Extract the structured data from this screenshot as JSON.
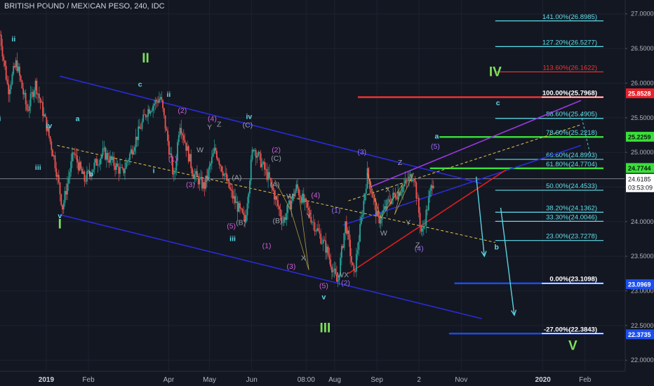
{
  "header": {
    "symbol_title": "BRITISH POUND / MEXICAN PESO, 240, IDC"
  },
  "colors": {
    "background": "#131722",
    "candle_up": "#26a69a",
    "candle_down": "#ef5350",
    "channel": "#2b2bd6",
    "fib_cyan": "#5ee0ea",
    "fib_red": "#ef3535",
    "fib_green": "#3ae03a",
    "fib_white": "#ffffff",
    "fib_blue": "#1c4ff0",
    "wave_green": "#7ee05a",
    "wave_cyan": "#62d6e4",
    "wave_magenta": "#d05cd8",
    "wave_purple": "#9a6cf0",
    "wave_gray": "#9a9ea8",
    "trend_yellow": "#e6c64a",
    "purple_channel": "#9a3ae0",
    "red_channel": "#e01e1e",
    "arrow": "#5ad2e0"
  },
  "chart_data": {
    "type": "candlestick",
    "title": "BRITISH POUND / MEXICAN PESO, 240, IDC",
    "x_axis": {
      "labels": [
        "2019",
        "Feb",
        "Apr",
        "May",
        "Jun",
        "08:00",
        "Aug",
        "Sep",
        "2",
        "Nov",
        "2020",
        "Feb"
      ],
      "positions_days": [
        0,
        31,
        90,
        120,
        151,
        191,
        212,
        243,
        274,
        305,
        365,
        396
      ],
      "range_days": [
        -34,
        425
      ]
    },
    "y_axis": {
      "labels": [
        "27.0000",
        "26.5000",
        "26.0000",
        "25.5000",
        "25.0000",
        "24.5000",
        "24.0000",
        "23.5000",
        "23.0000",
        "22.5000",
        "22.0000"
      ],
      "range": [
        21.85,
        27.2
      ],
      "current_price": "24.6185",
      "countdown": "03:53:09"
    },
    "price_path": [
      {
        "day": -34,
        "price": 26.7
      },
      {
        "day": -28,
        "price": 25.9
      },
      {
        "day": -22,
        "price": 26.3
      },
      {
        "day": -14,
        "price": 25.6
      },
      {
        "day": -8,
        "price": 26.0
      },
      {
        "day": 0,
        "price": 25.4
      },
      {
        "day": 6,
        "price": 24.9
      },
      {
        "day": 12,
        "price": 24.2
      },
      {
        "day": 20,
        "price": 25.0
      },
      {
        "day": 28,
        "price": 24.6
      },
      {
        "day": 42,
        "price": 25.0
      },
      {
        "day": 56,
        "price": 24.7
      },
      {
        "day": 74,
        "price": 25.6
      },
      {
        "day": 84,
        "price": 25.8
      },
      {
        "day": 94,
        "price": 24.6
      },
      {
        "day": 98,
        "price": 25.45
      },
      {
        "day": 108,
        "price": 24.7
      },
      {
        "day": 116,
        "price": 24.5
      },
      {
        "day": 124,
        "price": 25.05
      },
      {
        "day": 136,
        "price": 24.4
      },
      {
        "day": 146,
        "price": 24.0
      },
      {
        "day": 152,
        "price": 25.1
      },
      {
        "day": 164,
        "price": 24.6
      },
      {
        "day": 174,
        "price": 24.0
      },
      {
        "day": 184,
        "price": 24.5
      },
      {
        "day": 196,
        "price": 24.0
      },
      {
        "day": 206,
        "price": 23.6
      },
      {
        "day": 214,
        "price": 23.1
      },
      {
        "day": 220,
        "price": 24.0
      },
      {
        "day": 226,
        "price": 23.2
      },
      {
        "day": 236,
        "price": 24.7
      },
      {
        "day": 244,
        "price": 24.0
      },
      {
        "day": 252,
        "price": 24.3
      },
      {
        "day": 262,
        "price": 24.5
      },
      {
        "day": 270,
        "price": 24.7
      },
      {
        "day": 276,
        "price": 23.8
      },
      {
        "day": 284,
        "price": 24.6
      }
    ],
    "fib_levels": [
      {
        "label": "141.00%(26.8985)",
        "price": 26.8985,
        "color": "cyan"
      },
      {
        "label": "127.20%(26.5277)",
        "price": 26.5277,
        "color": "cyan"
      },
      {
        "label": "113.60%(26.1622)",
        "price": 26.1622,
        "color": "red"
      },
      {
        "label": "100.00%(25.7968)",
        "price": 25.7968,
        "color": "white"
      },
      {
        "label": "88.60%(25.4905)",
        "price": 25.4905,
        "color": "cyan"
      },
      {
        "label": "78.60%(25.2218)",
        "price": 25.2218,
        "color": "green"
      },
      {
        "label": "66.60%(24.8993)",
        "price": 24.8993,
        "color": "cyan"
      },
      {
        "label": "61.80%(24.7704)",
        "price": 24.7704,
        "color": "green"
      },
      {
        "label": "50.00%(24.4533)",
        "price": 24.4533,
        "color": "cyan"
      },
      {
        "label": "38.20%(24.1362)",
        "price": 24.1362,
        "color": "cyan"
      },
      {
        "label": "33.30%(24.0046)",
        "price": 24.0046,
        "color": "cyan"
      },
      {
        "label": "23.00%(23.7278)",
        "price": 23.7278,
        "color": "cyan"
      },
      {
        "label": "0.00%(23.1098)",
        "price": 23.1098,
        "color": "white"
      },
      {
        "label": "-27.00%(22.3843)",
        "price": 22.3843,
        "color": "white"
      }
    ],
    "price_tags": [
      {
        "text": "25.8528",
        "price": 25.8528,
        "bg": "#e8212a",
        "fg": "#ffffff"
      },
      {
        "text": "25.2259",
        "price": 25.2259,
        "bg": "#3ae03a",
        "fg": "#0c1a0c"
      },
      {
        "text": "24.7744",
        "price": 24.7744,
        "bg": "#3ae03a",
        "fg": "#0c1a0c"
      },
      {
        "text": "23.0969",
        "price": 23.0969,
        "bg": "#1c4ff0",
        "fg": "#ffffff"
      },
      {
        "text": "22.3735",
        "price": 22.3735,
        "bg": "#1c4ff0",
        "fg": "#ffffff"
      }
    ],
    "channels": [
      {
        "name": "upper-blue",
        "color": "channel",
        "from": [
          10,
          26.1
        ],
        "to": [
          320,
          24.55
        ]
      },
      {
        "name": "lower-blue",
        "color": "channel",
        "from": [
          10,
          24.1
        ],
        "to": [
          320,
          22.6
        ]
      },
      {
        "name": "purple-upper",
        "color": "purple_channel",
        "from": [
          238,
          24.5
        ],
        "to": [
          393,
          25.75
        ]
      },
      {
        "name": "blue-mid",
        "color": "channel",
        "from": [
          218,
          23.95
        ],
        "to": [
          393,
          25.1
        ]
      },
      {
        "name": "red-lower",
        "color": "red_channel",
        "from": [
          222,
          23.25
        ],
        "to": [
          338,
          24.75
        ]
      }
    ],
    "wave_labels": [
      {
        "text": "i",
        "day": -34,
        "price": 25.45,
        "color": "cyan"
      },
      {
        "text": "ii",
        "day": -24,
        "price": 26.6,
        "color": "cyan"
      },
      {
        "text": "iv",
        "day": 2,
        "price": 25.35,
        "color": "cyan"
      },
      {
        "text": "iii",
        "day": -6,
        "price": 24.75,
        "color": "cyan"
      },
      {
        "text": "v",
        "day": 10,
        "price": 24.05,
        "color": "cyan"
      },
      {
        "text": "I",
        "day": 10,
        "price": 23.9,
        "color": "green",
        "big": true
      },
      {
        "text": "a",
        "day": 23,
        "price": 25.45,
        "color": "cyan"
      },
      {
        "text": "b",
        "day": 33,
        "price": 24.65,
        "color": "cyan"
      },
      {
        "text": "c",
        "day": 69,
        "price": 25.95,
        "color": "cyan"
      },
      {
        "text": "II",
        "day": 73,
        "price": 26.3,
        "color": "green",
        "big": true
      },
      {
        "text": "ii",
        "day": 90,
        "price": 25.8,
        "color": "cyan"
      },
      {
        "text": "(2)",
        "day": 100,
        "price": 25.57,
        "color": "magenta"
      },
      {
        "text": "i",
        "day": 79,
        "price": 24.7,
        "color": "cyan"
      },
      {
        "text": "(1)",
        "day": 93,
        "price": 24.87,
        "color": "magenta"
      },
      {
        "text": "(3)",
        "day": 106,
        "price": 24.5,
        "color": "magenta"
      },
      {
        "text": "(4)",
        "day": 122,
        "price": 25.45,
        "color": "magenta"
      },
      {
        "text": "Y",
        "day": 120,
        "price": 25.33,
        "color": "gray"
      },
      {
        "text": "Z",
        "day": 127,
        "price": 25.37,
        "color": "gray"
      },
      {
        "text": "W",
        "day": 113,
        "price": 25.0,
        "color": "gray"
      },
      {
        "text": "X",
        "day": 119,
        "price": 24.58,
        "color": "gray"
      },
      {
        "text": "iv",
        "day": 149,
        "price": 25.48,
        "color": "cyan"
      },
      {
        "text": "(C)",
        "day": 148,
        "price": 25.36,
        "color": "gray"
      },
      {
        "text": "(5)",
        "day": 136,
        "price": 23.9,
        "color": "magenta"
      },
      {
        "text": "(B)",
        "day": 143,
        "price": 23.95,
        "color": "gray"
      },
      {
        "text": "iii",
        "day": 137,
        "price": 23.72,
        "color": "cyan"
      },
      {
        "text": "(A)",
        "day": 140,
        "price": 24.6,
        "color": "gray"
      },
      {
        "text": "(2)",
        "day": 169,
        "price": 25.0,
        "color": "magenta"
      },
      {
        "text": "(C)",
        "day": 169,
        "price": 24.88,
        "color": "gray"
      },
      {
        "text": "(A)",
        "day": 168,
        "price": 24.5,
        "color": "gray"
      },
      {
        "text": "(B)",
        "day": 170,
        "price": 23.98,
        "color": "gray"
      },
      {
        "text": "(1)",
        "day": 162,
        "price": 23.62,
        "color": "magenta"
      },
      {
        "text": "W",
        "day": 179,
        "price": 24.33,
        "color": "gray"
      },
      {
        "text": "Y",
        "day": 193,
        "price": 24.05,
        "color": "gray"
      },
      {
        "text": "X",
        "day": 189,
        "price": 23.44,
        "color": "gray"
      },
      {
        "text": "(3)",
        "day": 180,
        "price": 23.32,
        "color": "magenta"
      },
      {
        "text": "(4)",
        "day": 198,
        "price": 24.35,
        "color": "magenta"
      },
      {
        "text": "(5)",
        "day": 204,
        "price": 23.04,
        "color": "magenta"
      },
      {
        "text": "v",
        "day": 204,
        "price": 22.88,
        "color": "cyan"
      },
      {
        "text": "III",
        "day": 205,
        "price": 22.4,
        "color": "green",
        "big": true
      },
      {
        "text": "(1)",
        "day": 213,
        "price": 24.13,
        "color": "purple"
      },
      {
        "text": "WX",
        "day": 218,
        "price": 23.2,
        "color": "gray"
      },
      {
        "text": "(2)",
        "day": 220,
        "price": 23.08,
        "color": "purple"
      },
      {
        "text": "(3)",
        "day": 232,
        "price": 24.97,
        "color": "purple"
      },
      {
        "text": "W",
        "day": 248,
        "price": 23.8,
        "color": "gray"
      },
      {
        "text": "X",
        "day": 251,
        "price": 24.43,
        "color": "gray"
      },
      {
        "text": "Y",
        "day": 266,
        "price": 23.95,
        "color": "gray"
      },
      {
        "text": "Z",
        "day": 260,
        "price": 24.82,
        "color": "gray"
      },
      {
        "text": "(4)",
        "day": 274,
        "price": 23.58,
        "color": "purple"
      },
      {
        "text": "Z",
        "day": 273,
        "price": 23.63,
        "color": "gray"
      },
      {
        "text": "(5)",
        "day": 286,
        "price": 25.05,
        "color": "purple"
      },
      {
        "text": "a",
        "day": 287,
        "price": 25.2,
        "color": "cyan"
      },
      {
        "text": "IV",
        "day": 330,
        "price": 26.1,
        "color": "green",
        "big": true
      },
      {
        "text": "c",
        "day": 332,
        "price": 25.68,
        "color": "cyan"
      },
      {
        "text": "b",
        "day": 331,
        "price": 23.6,
        "color": "cyan"
      },
      {
        "text": "V",
        "day": 387,
        "price": 22.15,
        "color": "green",
        "big": true
      }
    ]
  }
}
